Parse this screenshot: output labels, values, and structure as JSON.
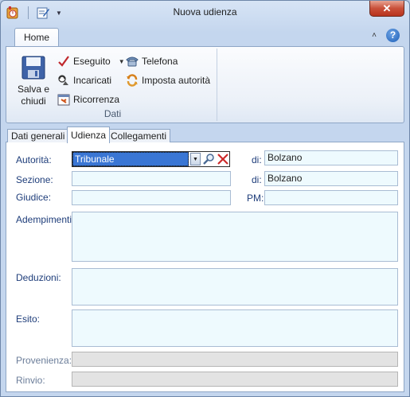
{
  "window": {
    "title": "Nuova udienza",
    "close_label": "✕"
  },
  "ribbon": {
    "tab_home": "Home",
    "group_dati": {
      "label": "Dati",
      "save_close_line1": "Salva e",
      "save_close_line2": "chiudi",
      "eseguito": "Eseguito",
      "incaricati": "Incaricati",
      "ricorrenza": "Ricorrenza",
      "telefona": "Telefona",
      "imposta_autorita": "Imposta autorità"
    }
  },
  "tabs": [
    "Dati generali",
    "Udienza",
    "Collegamenti"
  ],
  "active_tab": "Udienza",
  "form": {
    "autorita_label": "Autorità:",
    "autorita_value": "Tribunale",
    "autorita_di_label": "di:",
    "autorita_di_value": "Bolzano",
    "sezione_label": "Sezione:",
    "sezione_value": "",
    "sezione_di_label": "di:",
    "sezione_di_value": "Bolzano",
    "giudice_label": "Giudice:",
    "giudice_value": "",
    "pm_label": "PM:",
    "pm_value": "",
    "adempimenti_label": "Adempimenti:",
    "adempimenti_value": "",
    "deduzioni_label": "Deduzioni:",
    "deduzioni_value": "",
    "esito_label": "Esito:",
    "esito_value": "",
    "provenienza_label": "Provenienza:",
    "provenienza_value": "",
    "rinvio_label": "Rinvio:",
    "rinvio_value": ""
  },
  "colors": {
    "field_bg": "#eefafe",
    "selection": "#3a76d4",
    "label_blue": "#1e3d7a"
  },
  "icons": {
    "app": "outlook-appointment-icon",
    "qat_edit": "edit-form-icon",
    "save_close": "floppy-disk-icon",
    "eseguito": "checkmark-icon",
    "incaricati": "people-icon",
    "ricorrenza": "recurrence-icon",
    "telefona": "telephone-icon",
    "imposta_autorita": "refresh-icon",
    "search": "magnifier-icon",
    "clear": "red-x-icon",
    "help": "help-icon"
  }
}
